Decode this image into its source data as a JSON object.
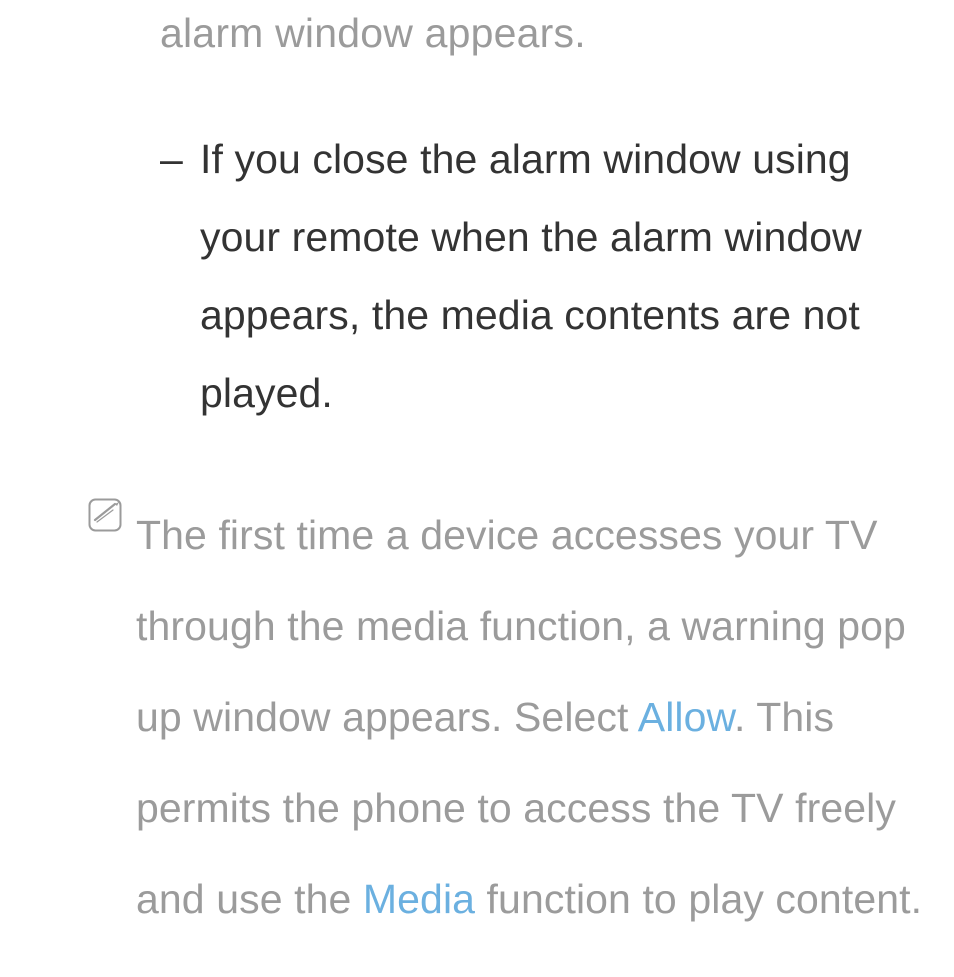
{
  "fragment_top": "alarm window appears.",
  "bullet": {
    "dash": "–",
    "text": "If you close the alarm window using your remote when the alarm window appears, the media contents are not played."
  },
  "note": {
    "pre": "The first time a device accesses your TV through the media function, a warning pop up window appears. Select ",
    "link1": "Allow",
    "after_link1": ". This permits the phone to access the TV freely and use the ",
    "link2": "Media",
    "post": " function to play content."
  }
}
